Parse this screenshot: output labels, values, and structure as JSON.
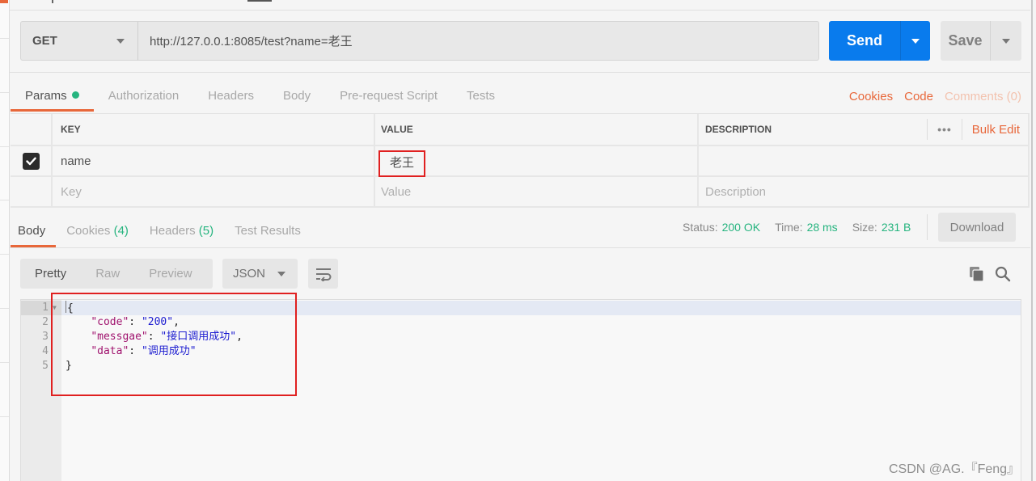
{
  "request": {
    "method": "GET",
    "url": "http://127.0.0.1:8085/test?name=老王",
    "send_label": "Send",
    "save_label": "Save"
  },
  "request_tabs": [
    {
      "label": "Params",
      "active": true,
      "has_indicator": true
    },
    {
      "label": "Authorization"
    },
    {
      "label": "Headers"
    },
    {
      "label": "Body"
    },
    {
      "label": "Pre-request Script"
    },
    {
      "label": "Tests"
    }
  ],
  "request_links": {
    "cookies": "Cookies",
    "code": "Code",
    "comments": "Comments (0)"
  },
  "params": {
    "headers": {
      "key": "KEY",
      "value": "VALUE",
      "description": "DESCRIPTION"
    },
    "more_label": "•••",
    "bulk_edit_label": "Bulk Edit",
    "rows": [
      {
        "checked": true,
        "key": "name",
        "value": "老王",
        "description": ""
      }
    ],
    "placeholders": {
      "key": "Key",
      "value": "Value",
      "description": "Description"
    }
  },
  "response_tabs": [
    {
      "label": "Body",
      "active": true
    },
    {
      "label": "Cookies",
      "count": "(4)"
    },
    {
      "label": "Headers",
      "count": "(5)"
    },
    {
      "label": "Test Results"
    }
  ],
  "response_status": {
    "status_label": "Status:",
    "status_value": "200 OK",
    "time_label": "Time:",
    "time_value": "28 ms",
    "size_label": "Size:",
    "size_value": "231 B",
    "download_label": "Download"
  },
  "body_toolbar": {
    "views": [
      "Pretty",
      "Raw",
      "Preview"
    ],
    "active_view": "Pretty",
    "format": "JSON"
  },
  "code": {
    "line_numbers": [
      "1",
      "2",
      "3",
      "4",
      "5"
    ],
    "lines": {
      "open": "{",
      "code_key": "\"code\"",
      "code_val": "\"200\"",
      "msg_key": "\"messgae\"",
      "msg_val": "\"接口调用成功\"",
      "data_key": "\"data\"",
      "data_val": "\"调用成功\"",
      "close": "}"
    }
  },
  "colors": {
    "accent_orange": "#e8673a",
    "send_blue": "#097bed",
    "success_green": "#26b47f",
    "highlight_red": "#e02020"
  },
  "watermark": "CSDN @AG.『Feng』"
}
